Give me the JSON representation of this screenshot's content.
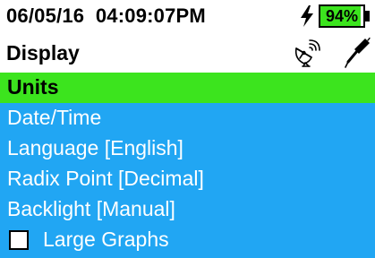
{
  "status": {
    "datetime": "06/05/16  04:09:07PM",
    "battery_percent": 94,
    "battery_label": "94%",
    "charging": true,
    "battery_color": "#3CE41E"
  },
  "title": "Display",
  "icons": {
    "satellite": "satellite-dish-icon",
    "probe": "probe-icon"
  },
  "menu": {
    "items": [
      {
        "label": "Units",
        "selected": true
      },
      {
        "label": "Date/Time",
        "selected": false
      },
      {
        "label": "Language [English]",
        "selected": false
      },
      {
        "label": "Radix Point [Decimal]",
        "selected": false
      },
      {
        "label": "Backlight [Manual]",
        "selected": false
      },
      {
        "label": "Large Graphs",
        "selected": false,
        "checkbox": true,
        "checked": false
      }
    ],
    "colors": {
      "item_bg": "#21A6F3",
      "selected_bg": "#3CE41E"
    }
  }
}
